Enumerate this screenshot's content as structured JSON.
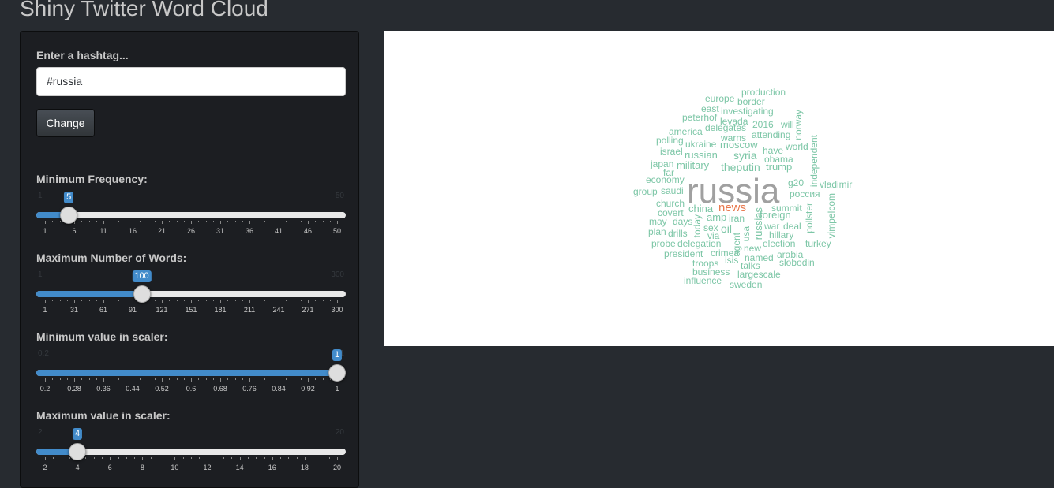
{
  "app": {
    "title": "Shiny Twitter Word Cloud"
  },
  "hashtag": {
    "label": "Enter a hashtag...",
    "value": "#russia"
  },
  "change_button": {
    "label": "Change"
  },
  "sliders": [
    {
      "id": "min-frequency",
      "label": "Minimum Frequency:",
      "min": 1,
      "max": 50,
      "value": 5,
      "min_label": "1",
      "max_label": "50",
      "value_label": "5",
      "ticks": [
        "1",
        "6",
        "11",
        "16",
        "21",
        "26",
        "31",
        "36",
        "41",
        "46",
        "50"
      ]
    },
    {
      "id": "max-words",
      "label": "Maximum Number of Words:",
      "min": 1,
      "max": 300,
      "value": 100,
      "min_label": "1",
      "max_label": "300",
      "value_label": "100",
      "ticks": [
        "1",
        "31",
        "61",
        "91",
        "121",
        "151",
        "181",
        "211",
        "241",
        "271",
        "300"
      ]
    },
    {
      "id": "min-scaler",
      "label": "Minimum value in scaler:",
      "min": 0.2,
      "max": 1,
      "value": 1,
      "min_label": "0.2",
      "max_label": "1",
      "value_label": "1",
      "ticks": [
        "0.2",
        "0.28",
        "0.36",
        "0.44",
        "0.52",
        "0.6",
        "0.68",
        "0.76",
        "0.84",
        "0.92",
        "1"
      ]
    },
    {
      "id": "max-scaler",
      "label": "Maximum value in scaler:",
      "min": 2,
      "max": 20,
      "value": 4,
      "min_label": "2",
      "max_label": "20",
      "value_label": "4",
      "ticks": [
        "2",
        "4",
        "6",
        "8",
        "10",
        "12",
        "14",
        "16",
        "18",
        "20"
      ]
    }
  ],
  "colors": {
    "accent": "#428bca",
    "word_main": "#a0a0a0",
    "word_highlight": "#e8784d",
    "word_default": "#7cc6a6"
  },
  "wordcloud": {
    "words": [
      {
        "t": "russia",
        "c": "main"
      },
      {
        "t": "news",
        "c": "hl"
      },
      {
        "t": "production"
      },
      {
        "t": "europe"
      },
      {
        "t": "border"
      },
      {
        "t": "east"
      },
      {
        "t": "investigating"
      },
      {
        "t": "peterhof"
      },
      {
        "t": "levada"
      },
      {
        "t": "2016"
      },
      {
        "t": "will"
      },
      {
        "t": "norway"
      },
      {
        "t": "america"
      },
      {
        "t": "delegates"
      },
      {
        "t": "attending"
      },
      {
        "t": "polling"
      },
      {
        "t": "warns"
      },
      {
        "t": "ukraine"
      },
      {
        "t": "moscow"
      },
      {
        "t": "world"
      },
      {
        "t": "israel"
      },
      {
        "t": "have"
      },
      {
        "t": "russian"
      },
      {
        "t": "syria"
      },
      {
        "t": "independent"
      },
      {
        "t": "obama"
      },
      {
        "t": "japan"
      },
      {
        "t": "military"
      },
      {
        "t": "theputin"
      },
      {
        "t": "trump"
      },
      {
        "t": "far"
      },
      {
        "t": "economy"
      },
      {
        "t": "g20"
      },
      {
        "t": "vladimir"
      },
      {
        "t": "group"
      },
      {
        "t": "saudi"
      },
      {
        "t": "россия"
      },
      {
        "t": "church"
      },
      {
        "t": "summit"
      },
      {
        "t": "china"
      },
      {
        "t": "covert"
      },
      {
        "t": "russias"
      },
      {
        "t": "foreign"
      },
      {
        "t": "pollster"
      },
      {
        "t": "may"
      },
      {
        "t": "days"
      },
      {
        "t": "amp"
      },
      {
        "t": "iran"
      },
      {
        "t": "today"
      },
      {
        "t": "vimpelcom"
      },
      {
        "t": "plan"
      },
      {
        "t": "sex"
      },
      {
        "t": "oil"
      },
      {
        "t": "usa"
      },
      {
        "t": "agent"
      },
      {
        "t": "war"
      },
      {
        "t": "deal"
      },
      {
        "t": "drills"
      },
      {
        "t": "via"
      },
      {
        "t": "hillary"
      },
      {
        "t": "probe"
      },
      {
        "t": "delegation"
      },
      {
        "t": "new"
      },
      {
        "t": "election"
      },
      {
        "t": "turkey"
      },
      {
        "t": "president"
      },
      {
        "t": "crimea"
      },
      {
        "t": "arabia"
      },
      {
        "t": "named"
      },
      {
        "t": "isis"
      },
      {
        "t": "slobodin"
      },
      {
        "t": "troops"
      },
      {
        "t": "talks"
      },
      {
        "t": "business"
      },
      {
        "t": "largescale"
      },
      {
        "t": "influence"
      },
      {
        "t": "sweden"
      }
    ]
  }
}
